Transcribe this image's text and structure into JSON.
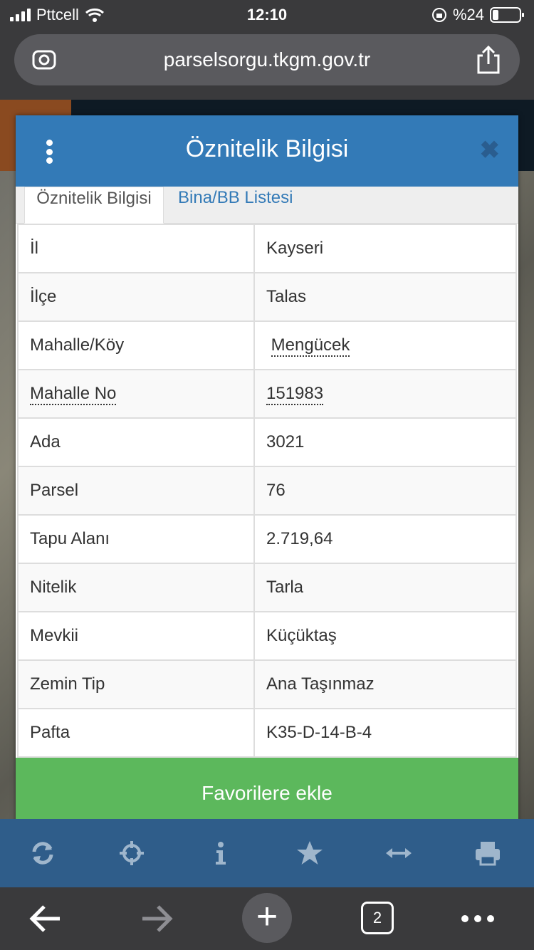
{
  "status_bar": {
    "carrier": "Pttcell",
    "time": "12:10",
    "battery": "%24"
  },
  "browser": {
    "url": "parselsorgu.tkgm.gov.tr"
  },
  "modal": {
    "title": "Öznitelik Bilgisi",
    "close_glyph": "✖",
    "tabs": [
      {
        "label": "Öznitelik Bilgisi",
        "active": true
      },
      {
        "label": "Bina/BB Listesi",
        "active": false
      }
    ],
    "rows": [
      {
        "key": "İl",
        "value": "Kayseri"
      },
      {
        "key": "İlçe",
        "value": "Talas"
      },
      {
        "key": "Mahalle/Köy",
        "value": "Mengücek"
      },
      {
        "key": "Mahalle No",
        "value": "151983"
      },
      {
        "key": "Ada",
        "value": "3021"
      },
      {
        "key": "Parsel",
        "value": "76"
      },
      {
        "key": "Tapu Alanı",
        "value": "2.719,64"
      },
      {
        "key": "Nitelik",
        "value": "Tarla"
      },
      {
        "key": "Mevkii",
        "value": "Küçüktaş"
      },
      {
        "key": "Zemin Tip",
        "value": "Ana Taşınmaz"
      },
      {
        "key": "Pafta",
        "value": "K35-D-14-B-4"
      }
    ],
    "favorite_button": "Favorilere ekle"
  },
  "map_toolbar": {
    "icons": [
      "refresh-icon",
      "locate-icon",
      "info-icon",
      "star-icon",
      "measure-icon",
      "print-icon"
    ]
  },
  "browser_bottom": {
    "tab_count": "2"
  },
  "colors": {
    "header": "#337ab7",
    "favorite": "#5cb85c",
    "toolbar": "#2f5d8a"
  }
}
